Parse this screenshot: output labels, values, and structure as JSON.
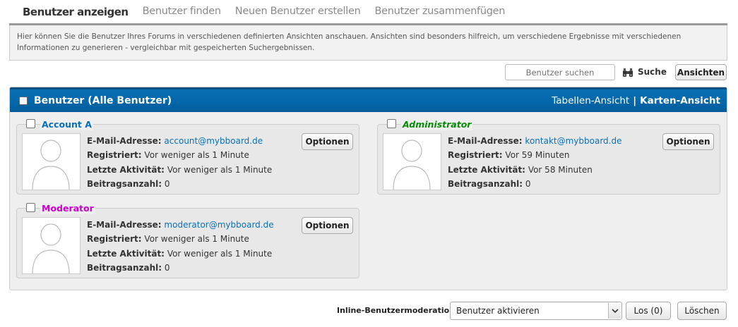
{
  "tabs": [
    {
      "label": "Benutzer anzeigen",
      "active": true
    },
    {
      "label": "Benutzer finden",
      "active": false
    },
    {
      "label": "Neuen Benutzer erstellen",
      "active": false
    },
    {
      "label": "Benutzer zusammenfügen",
      "active": false
    }
  ],
  "info_text": "Hier können Sie die Benutzer Ihres Forums in verschiedenen definierten Ansichten anschauen. Ansichten sind besonders hilfreich, um verschiedene Ergebnisse mit verschiedenen Informationen zu generieren - vergleichbar mit gespeicherten Suchergebnissen.",
  "search": {
    "placeholder": "Benutzer suchen",
    "button_label": "Suche",
    "icon": "binoculars-icon"
  },
  "views_button": "Ansichten",
  "panel": {
    "title": "Benutzer (Alle Benutzer)",
    "table_view": "Tabellen-Ansicht",
    "separator": "|",
    "card_view": "Karten-Ansicht"
  },
  "field_labels": {
    "email": "E-Mail-Adresse:",
    "registered": "Registriert:",
    "last_activity": "Letzte Aktivität:",
    "post_count": "Beitragsanzahl:"
  },
  "options_label": "Optionen",
  "users": [
    {
      "name": "Account A",
      "name_color": "#0b6fb5",
      "italic": false,
      "email": "account@mybboard.de",
      "registered": "Vor weniger als 1 Minute",
      "last_activity": "Vor weniger als 1 Minute",
      "posts": "0"
    },
    {
      "name": "Administrator",
      "name_color": "#078c07",
      "italic": true,
      "email": "kontakt@mybboard.de",
      "registered": "Vor 59 Minuten",
      "last_activity": "Vor 58 Minuten",
      "posts": "0"
    },
    {
      "name": "Moderator",
      "name_color": "#cc00cc",
      "italic": false,
      "email": "moderator@mybboard.de",
      "registered": "Vor weniger als 1 Minute",
      "last_activity": "Vor weniger als 1 Minute",
      "posts": "0"
    }
  ],
  "moderation": {
    "label": "Inline-Benutzermoderation:",
    "selected": "Benutzer aktivieren",
    "go_button": "Los (0)",
    "clear_button": "Löschen"
  },
  "colors": {
    "header_blue": "#0266a8",
    "link_blue": "#0b6fb5"
  }
}
